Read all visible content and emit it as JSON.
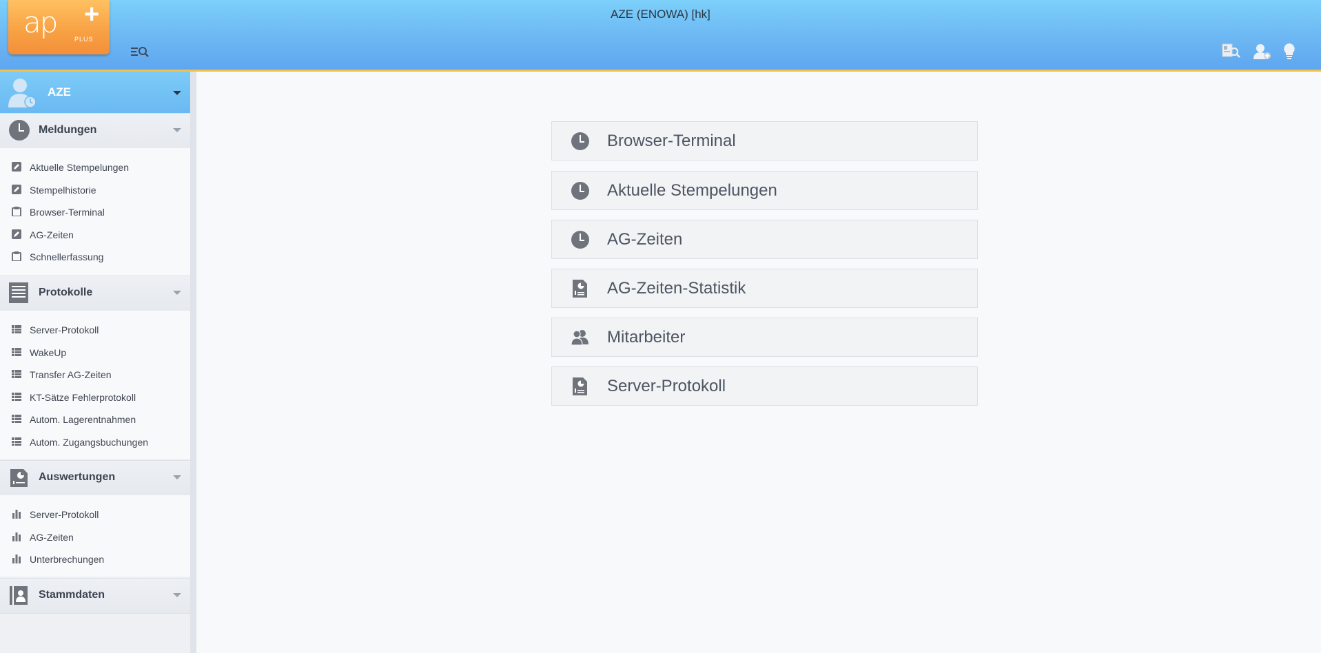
{
  "header": {
    "logo": {
      "text": "ap",
      "sub": "PLUS"
    },
    "title": "AZE (ENOWA) [hk]",
    "icons": [
      "menu-search-icon",
      "screen-search-icon",
      "user-add-icon",
      "lightbulb-icon"
    ]
  },
  "sidebar": {
    "module": {
      "label": "AZE",
      "icon": "user-clock-icon"
    },
    "groups": [
      {
        "label": "Meldungen",
        "icon": "clock-icon",
        "items": [
          {
            "label": "Aktuelle Stempelungen",
            "icon": "edit-icon"
          },
          {
            "label": "Stempelhistorie",
            "icon": "edit-icon"
          },
          {
            "label": "Browser-Terminal",
            "icon": "clipboard-icon"
          },
          {
            "label": "AG-Zeiten",
            "icon": "edit-icon"
          },
          {
            "label": "Schnellerfassung",
            "icon": "clipboard-icon"
          }
        ]
      },
      {
        "label": "Protokolle",
        "icon": "log-icon",
        "items": [
          {
            "label": "Server-Protokoll",
            "icon": "table-icon"
          },
          {
            "label": "WakeUp",
            "icon": "table-icon"
          },
          {
            "label": "Transfer AG-Zeiten",
            "icon": "table-icon"
          },
          {
            "label": "KT-Sätze Fehlerprotokoll",
            "icon": "table-icon"
          },
          {
            "label": "Autom. Lagerentnahmen",
            "icon": "table-icon"
          },
          {
            "label": "Autom. Zugangsbuchungen",
            "icon": "table-icon"
          }
        ]
      },
      {
        "label": "Auswertungen",
        "icon": "report-icon",
        "items": [
          {
            "label": "Server-Protokoll",
            "icon": "bar-chart-icon"
          },
          {
            "label": "AG-Zeiten",
            "icon": "bar-chart-icon"
          },
          {
            "label": "Unterbrechungen",
            "icon": "bar-chart-icon"
          }
        ]
      },
      {
        "label": "Stammdaten",
        "icon": "master-data-icon",
        "items": []
      }
    ]
  },
  "main": {
    "tiles": [
      {
        "label": "Browser-Terminal",
        "icon": "clock-icon"
      },
      {
        "label": "Aktuelle Stempelungen",
        "icon": "clock-icon"
      },
      {
        "label": "AG-Zeiten",
        "icon": "clock-icon"
      },
      {
        "label": "AG-Zeiten-Statistik",
        "icon": "report-icon"
      },
      {
        "label": "Mitarbeiter",
        "icon": "users-icon"
      },
      {
        "label": "Server-Protokoll",
        "icon": "report-icon"
      }
    ]
  },
  "colors": {
    "header_top": "#7cd0fa",
    "header_bottom": "#5fa6ef",
    "accent_line": "#f0c14d",
    "logo_orange": "#f7a043",
    "icon_grey": "#6f747c"
  }
}
